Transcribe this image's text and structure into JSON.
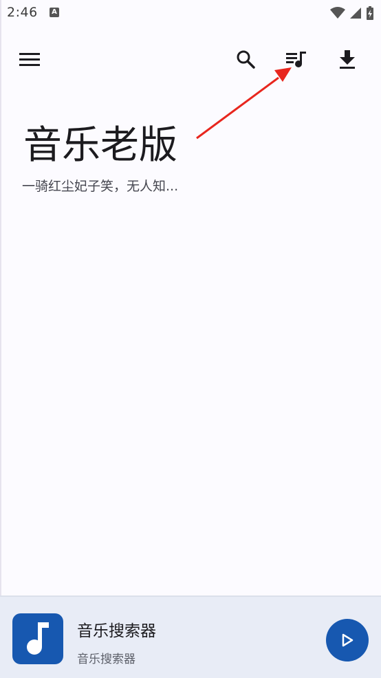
{
  "status_bar": {
    "time": "2:46",
    "app_indicator": "A"
  },
  "toolbar": {
    "menu_icon": "menu-icon",
    "search_icon": "search-icon",
    "playlist_icon": "queue-music-icon",
    "download_icon": "download-icon"
  },
  "header": {
    "title": "音乐老版",
    "subtitle": "一骑红尘妃子笑，无人知..."
  },
  "player": {
    "title": "音乐搜索器",
    "subtitle": "音乐搜索器",
    "album_icon": "music-note-icon",
    "play_icon": "play-icon"
  },
  "colors": {
    "background": "#fcfbff",
    "accent": "#1758b0",
    "player_bg": "#e8ecf6",
    "arrow": "#e8261e"
  }
}
